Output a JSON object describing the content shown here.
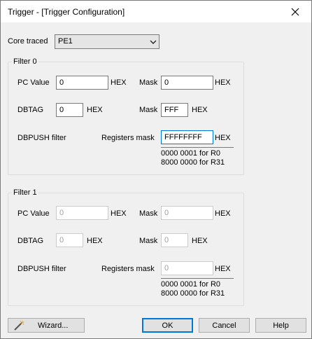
{
  "window": {
    "title": "Trigger - [Trigger Configuration]"
  },
  "core": {
    "label": "Core traced",
    "value": "PE1"
  },
  "filters": [
    {
      "title": "Filter 0",
      "pc_label": "PC Value",
      "pc_value": "0",
      "pc_unit": "HEX",
      "pc_mask_label": "Mask",
      "pc_mask_value": "0",
      "pc_mask_unit": "HEX",
      "dbtag_label": "DBTAG",
      "dbtag_value": "0",
      "dbtag_unit": "HEX",
      "dbtag_mask_label": "Mask",
      "dbtag_mask_value": "FFF",
      "dbtag_mask_unit": "HEX",
      "dbpush_label": "DBPUSH filter",
      "reg_mask_label": "Registers mask",
      "reg_mask_value": "FFFFFFFF",
      "reg_mask_unit": "HEX",
      "hint1": "0000 0001 for R0",
      "hint2": "8000 0000 for R31"
    },
    {
      "title": "Filter 1",
      "pc_label": "PC Value",
      "pc_value": "0",
      "pc_unit": "HEX",
      "pc_mask_label": "Mask",
      "pc_mask_value": "0",
      "pc_mask_unit": "HEX",
      "dbtag_label": "DBTAG",
      "dbtag_value": "0",
      "dbtag_unit": "HEX",
      "dbtag_mask_label": "Mask",
      "dbtag_mask_value": "0",
      "dbtag_mask_unit": "HEX",
      "dbpush_label": "DBPUSH filter",
      "reg_mask_label": "Registers mask",
      "reg_mask_value": "0",
      "reg_mask_unit": "HEX",
      "hint1": "0000 0001 for R0",
      "hint2": "8000 0000 for R31"
    }
  ],
  "buttons": {
    "wizard": "Wizard...",
    "ok": "OK",
    "cancel": "Cancel",
    "help": "Help"
  },
  "colors": {
    "focus": "#0078d7",
    "disabled_text": "#a0a0a0"
  }
}
